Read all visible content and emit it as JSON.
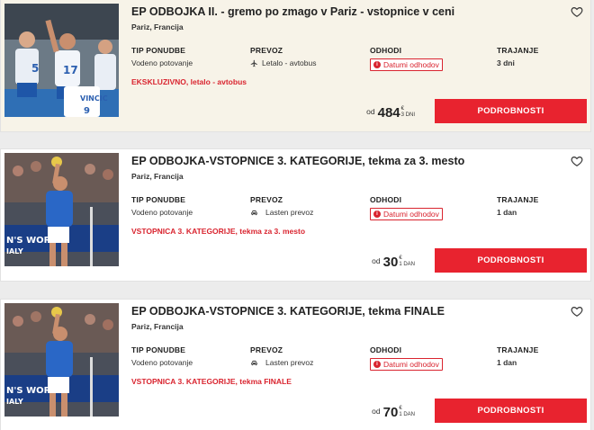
{
  "labels": {
    "type": "TIP PONUDBE",
    "transport": "PREVOZ",
    "departures": "ODHODI",
    "duration": "TRAJANJE",
    "dates_button": "Datumi odhodov",
    "price_prefix": "od",
    "details_button": "PODROBNOSTI"
  },
  "offers": [
    {
      "title": "EP ODBOJKA II. - gremo po zmago v Pariz - vstopnice v ceni",
      "location": "Pariz, Francija",
      "type": "Vodeno potovanje",
      "transport": "Letalo - avtobus",
      "transport_icon": "plane-icon",
      "duration": "3 dni",
      "promo": "EKSKLUZIVNO, letalo - avtobus",
      "price": "484",
      "currency": "€",
      "price_unit": "3 DNI",
      "highlight": true
    },
    {
      "title": "EP ODBOJKA-VSTOPNICE 3. KATEGORIJE, tekma za 3. mesto",
      "location": "Pariz, Francija",
      "type": "Vodeno potovanje",
      "transport": "Lasten prevoz",
      "transport_icon": "car-icon",
      "duration": "1 dan",
      "promo": "VSTOPNICA 3. KATEGORIJE, tekma za 3. mesto",
      "price": "30",
      "currency": "€",
      "price_unit": "1 DAN",
      "highlight": false
    },
    {
      "title": "EP ODBOJKA-VSTOPNICE 3. KATEGORIJE, tekma FINALE",
      "location": "Pariz, Francija",
      "type": "Vodeno potovanje",
      "transport": "Lasten prevoz",
      "transport_icon": "car-icon",
      "duration": "1 dan",
      "promo": "VSTOPNICA 3. KATEGORIJE, tekma FINALE",
      "price": "70",
      "currency": "€",
      "price_unit": "1 DAN",
      "highlight": false
    }
  ],
  "colors": {
    "accent": "#e8232f",
    "highlight_bg": "#f7f3e8"
  }
}
